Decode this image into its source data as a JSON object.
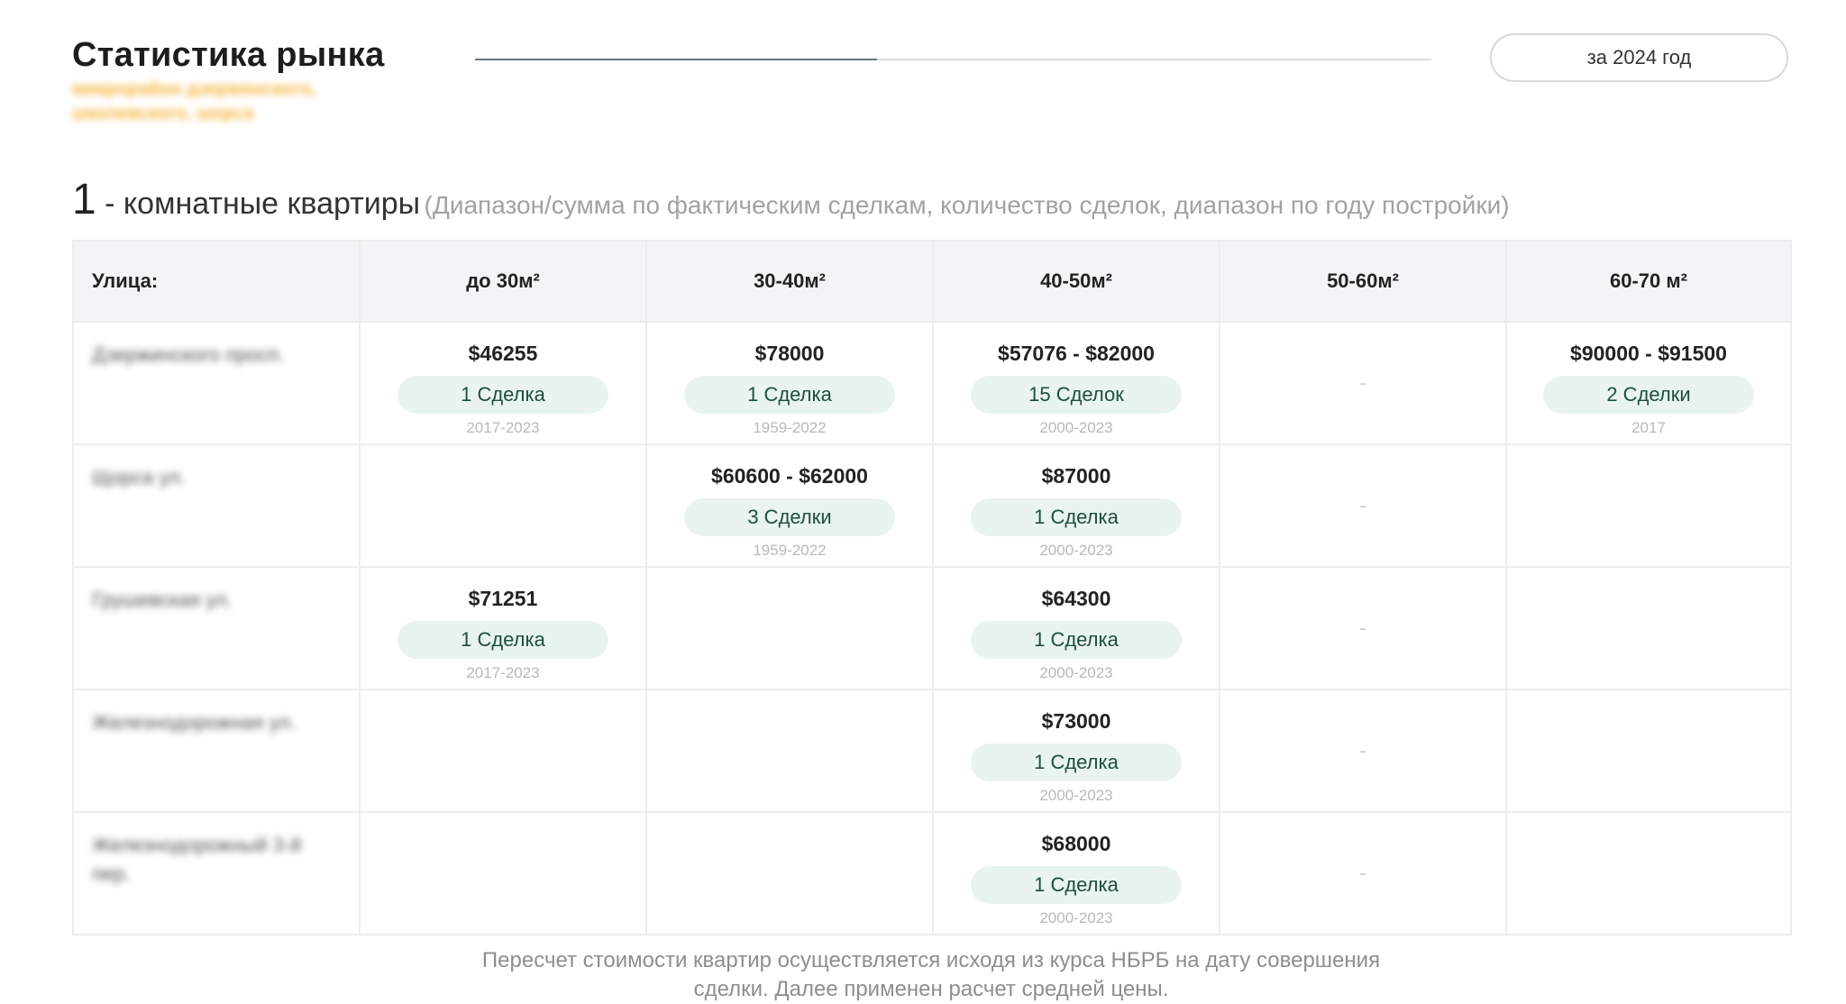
{
  "header": {
    "title": "Статистика рынка",
    "subtitle": "микрорайон дзержинского, школевского, шорса",
    "year_button": "за 2024 год",
    "progress": 0.42
  },
  "section": {
    "number": "1",
    "label": " - комнатные квартиры",
    "note": "(Диапазон/сумма по фактическим сделкам, количество сделок, диапазон по году постройки)"
  },
  "table": {
    "columns": [
      "Улица:",
      "до 30м²",
      "30-40м²",
      "40-50м²",
      "50-60м²",
      "60-70 м²"
    ],
    "empty_mark": "-",
    "rows": [
      {
        "street": "Дзержинского просп.",
        "cells": [
          {
            "price": "$46255",
            "deals": "1 Сделка",
            "years": "2017-2023"
          },
          {
            "price": "$78000",
            "deals": "1 Сделка",
            "years": "1959-2022"
          },
          {
            "price": "$57076 - $82000",
            "deals": "15 Сделок",
            "years": "2000-2023"
          },
          null,
          {
            "price": "$90000 - $91500",
            "deals": "2 Сделки",
            "years": "2017"
          }
        ]
      },
      {
        "street": "Щорса ул.",
        "cells": [
          null,
          {
            "price": "$60600 - $62000",
            "deals": "3 Сделки",
            "years": "1959-2022"
          },
          {
            "price": "$87000",
            "deals": "1 Сделка",
            "years": "2000-2023"
          },
          null,
          null
        ]
      },
      {
        "street": "Грушевская ул.",
        "cells": [
          {
            "price": "$71251",
            "deals": "1 Сделка",
            "years": "2017-2023"
          },
          null,
          {
            "price": "$64300",
            "deals": "1 Сделка",
            "years": "2000-2023"
          },
          null,
          null
        ]
      },
      {
        "street": "Железнодорожная ул.",
        "cells": [
          null,
          null,
          {
            "price": "$73000",
            "deals": "1 Сделка",
            "years": "2000-2023"
          },
          null,
          null
        ]
      },
      {
        "street": "Железнодорожный 3-й пер.",
        "cells": [
          null,
          null,
          {
            "price": "$68000",
            "deals": "1 Сделка",
            "years": "2000-2023"
          },
          null,
          null
        ]
      }
    ]
  },
  "footnote": {
    "line1": "Пересчет стоимости квартир осуществляется исходя из курса НБРБ на дату совершения",
    "line2": "сделки. Далее применен расчет средней цены."
  },
  "colors": {
    "accent_pill": "#e9f4ef",
    "pill_text": "#1f4f3a",
    "subtitle": "#f6b43a",
    "header_bg": "#f3f4f5"
  }
}
